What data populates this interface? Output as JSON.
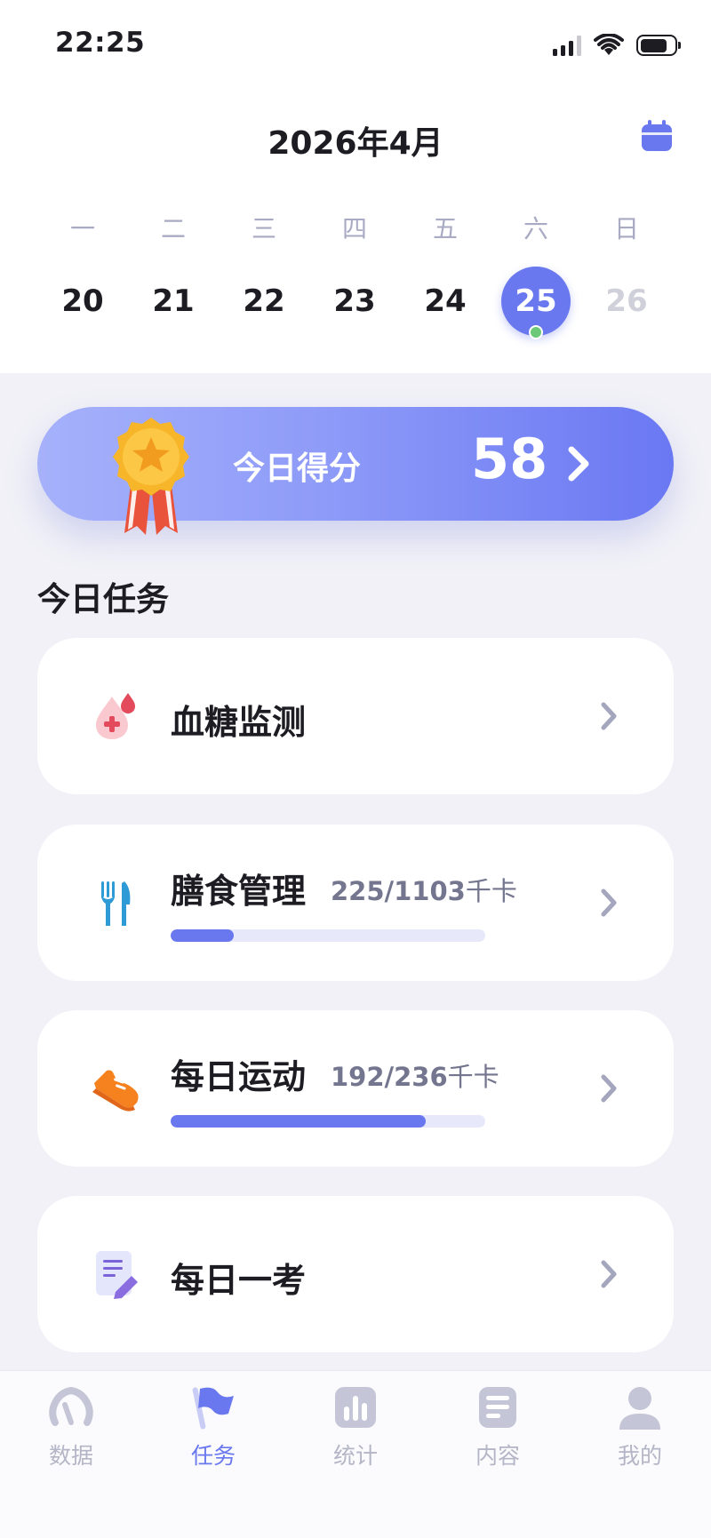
{
  "status_bar": {
    "time": "22:25"
  },
  "header": {
    "month_title": "2026年4月"
  },
  "week": {
    "days": [
      {
        "dow": "一",
        "num": "20"
      },
      {
        "dow": "二",
        "num": "21"
      },
      {
        "dow": "三",
        "num": "22"
      },
      {
        "dow": "四",
        "num": "23"
      },
      {
        "dow": "五",
        "num": "24"
      },
      {
        "dow": "六",
        "num": "25"
      },
      {
        "dow": "日",
        "num": "26"
      }
    ],
    "selected_day": "25"
  },
  "score": {
    "label": "今日得分",
    "value": "58"
  },
  "tasks_section": {
    "title": "今日任务"
  },
  "tasks": [
    {
      "title": "血糖监测",
      "icon": "blood-drop-icon"
    },
    {
      "title": "膳食管理",
      "icon": "fork-knife-icon",
      "progress_text": "225/1103",
      "unit": "千卡",
      "progress": 0.2
    },
    {
      "title": "每日运动",
      "icon": "sneaker-icon",
      "progress_text": "192/236",
      "unit": "千卡",
      "progress": 0.81
    },
    {
      "title": "每日一考",
      "icon": "exam-note-icon"
    }
  ],
  "tabbar": {
    "items": [
      {
        "label": "数据",
        "icon": "gauge-icon"
      },
      {
        "label": "任务",
        "icon": "flag-icon"
      },
      {
        "label": "统计",
        "icon": "bar-chart-icon"
      },
      {
        "label": "内容",
        "icon": "document-icon"
      },
      {
        "label": "我的",
        "icon": "person-icon"
      }
    ],
    "active": "任务"
  },
  "colors": {
    "accent": "#6a78ef",
    "background": "#f1f1f7",
    "progress_track": "#e7e9fb",
    "dot_green": "#6bc979"
  }
}
